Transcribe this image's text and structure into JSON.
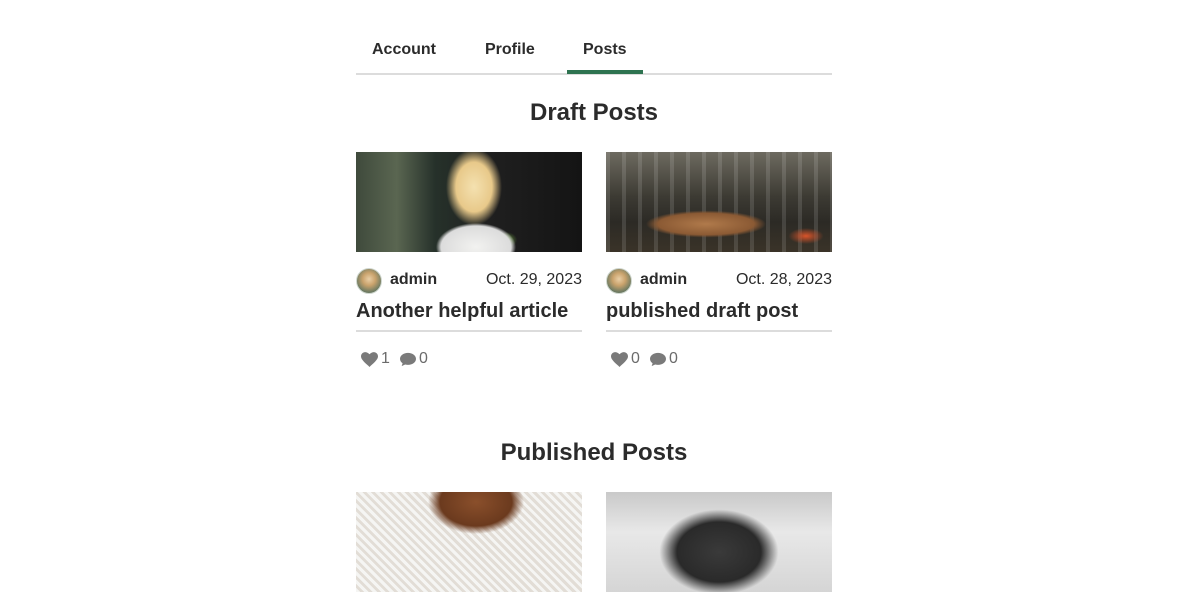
{
  "tabs": {
    "account": "Account",
    "profile": "Profile",
    "posts": "Posts"
  },
  "sections": {
    "draft_title": "Draft Posts",
    "published_title": "Published Posts"
  },
  "draft_posts": [
    {
      "author": "admin",
      "date": "Oct. 29, 2023",
      "title": "Another helpful article",
      "likes": "1",
      "comments": "0"
    },
    {
      "author": "admin",
      "date": "Oct. 28, 2023",
      "title": "published draft post",
      "likes": "0",
      "comments": "0"
    }
  ],
  "colors": {
    "accent": "#2e7350",
    "divider": "#dcdcdc",
    "text": "#2b2b2b",
    "muted": "#6b6b6b"
  },
  "icons": {
    "like": "heart-icon",
    "comment": "comment-bubble-icon"
  }
}
